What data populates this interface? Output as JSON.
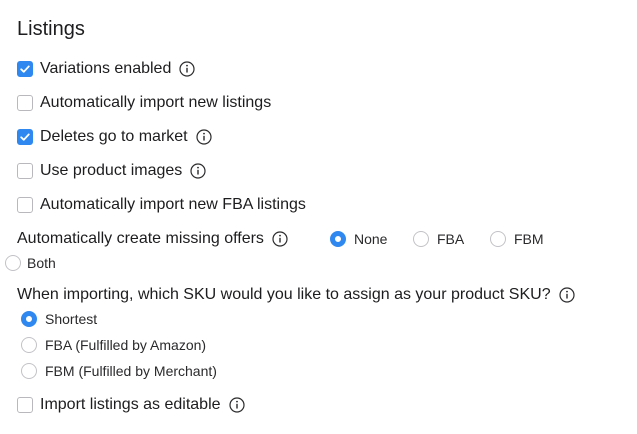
{
  "section": {
    "title": "Listings"
  },
  "options": {
    "variations_enabled": {
      "label": "Variations enabled",
      "checked": true
    },
    "auto_import_new": {
      "label": "Automatically import new listings",
      "checked": false
    },
    "deletes_to_market": {
      "label": "Deletes go to market",
      "checked": true
    },
    "use_product_images": {
      "label": "Use product images",
      "checked": false
    },
    "auto_import_fba": {
      "label": "Automatically import new FBA listings",
      "checked": false
    },
    "import_editable": {
      "label": "Import listings as editable",
      "checked": false
    }
  },
  "missing_offers": {
    "label": "Automatically create missing offers",
    "options": [
      "None",
      "FBA",
      "FBM",
      "Both"
    ],
    "selected": "None"
  },
  "sku_assignment": {
    "question": "When importing, which SKU would you like to assign as your product SKU?",
    "options": [
      "Shortest",
      "FBA (Fulfilled by Amazon)",
      "FBM (Fulfilled by Merchant)"
    ],
    "selected": "Shortest"
  },
  "colors": {
    "accent": "#2f88f0",
    "text": "#1d1d1f",
    "border": "#b9b9bd"
  },
  "icons": {
    "info": "info-circle-icon",
    "check": "checkmark-icon"
  }
}
